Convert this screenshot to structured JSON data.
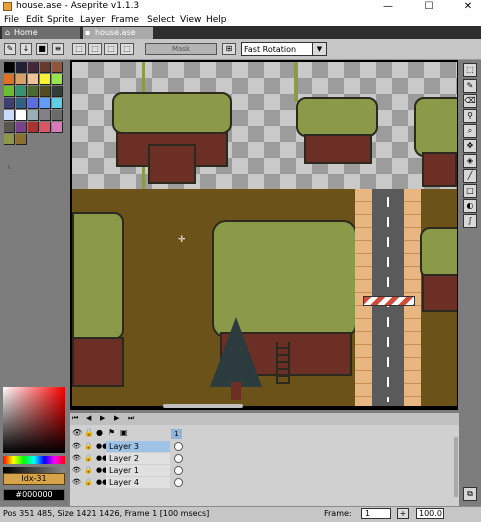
{
  "window": {
    "title": "house.ase - Aseprite v1.1.3",
    "minimize_glyph": "—",
    "maximize_glyph": "☐",
    "close_glyph": "✕"
  },
  "menu": [
    "File",
    "Edit",
    "Sprite",
    "Layer",
    "Frame",
    "Select",
    "View",
    "Help"
  ],
  "tabs": {
    "home": "Home",
    "active": "house.ase"
  },
  "context_bar": {
    "mask_label": "Mask",
    "resize_method": "Fast Rotation"
  },
  "palette": {
    "swatches": [
      "#000000",
      "#222034",
      "#45283c",
      "#663931",
      "#8f563b",
      "#df7126",
      "#d9a066",
      "#eec39a",
      "#fbf236",
      "#99e550",
      "#6abe30",
      "#37946e",
      "#4b692f",
      "#524b24",
      "#323c39",
      "#3f3f74",
      "#306082",
      "#5b6ee1",
      "#639bff",
      "#5fcde4",
      "#cbdbfc",
      "#ffffff",
      "#9badb7",
      "#847e87",
      "#696a6a",
      "#595652",
      "#76428a",
      "#ac3232",
      "#d95763",
      "#d77bba",
      "#8f974a",
      "#8a6f30"
    ],
    "index_label": "Idx-31",
    "hex_label": "#000000"
  },
  "timeline": {
    "frame_number": "1",
    "layers": [
      {
        "name": "Layer 3",
        "selected": true
      },
      {
        "name": "Layer 2",
        "selected": false
      },
      {
        "name": "Layer 1",
        "selected": false
      },
      {
        "name": "Layer 4",
        "selected": false
      }
    ]
  },
  "status": {
    "info": "Pos 351 485, Size 1421 1426, Frame 1 [100 msecs]",
    "frame_label": "Frame:",
    "frame_value": "1",
    "add_frame": "+",
    "zoom": "100.0"
  },
  "colors": {
    "grass_dark": "#6b5218",
    "canopy": "#8b9a48",
    "trunk": "#6b2f26",
    "road": "#5a5a5a",
    "sidewalk": "#e8b681",
    "tab_active": "#a9a9a9",
    "layer_selected": "#9fc3e6"
  }
}
